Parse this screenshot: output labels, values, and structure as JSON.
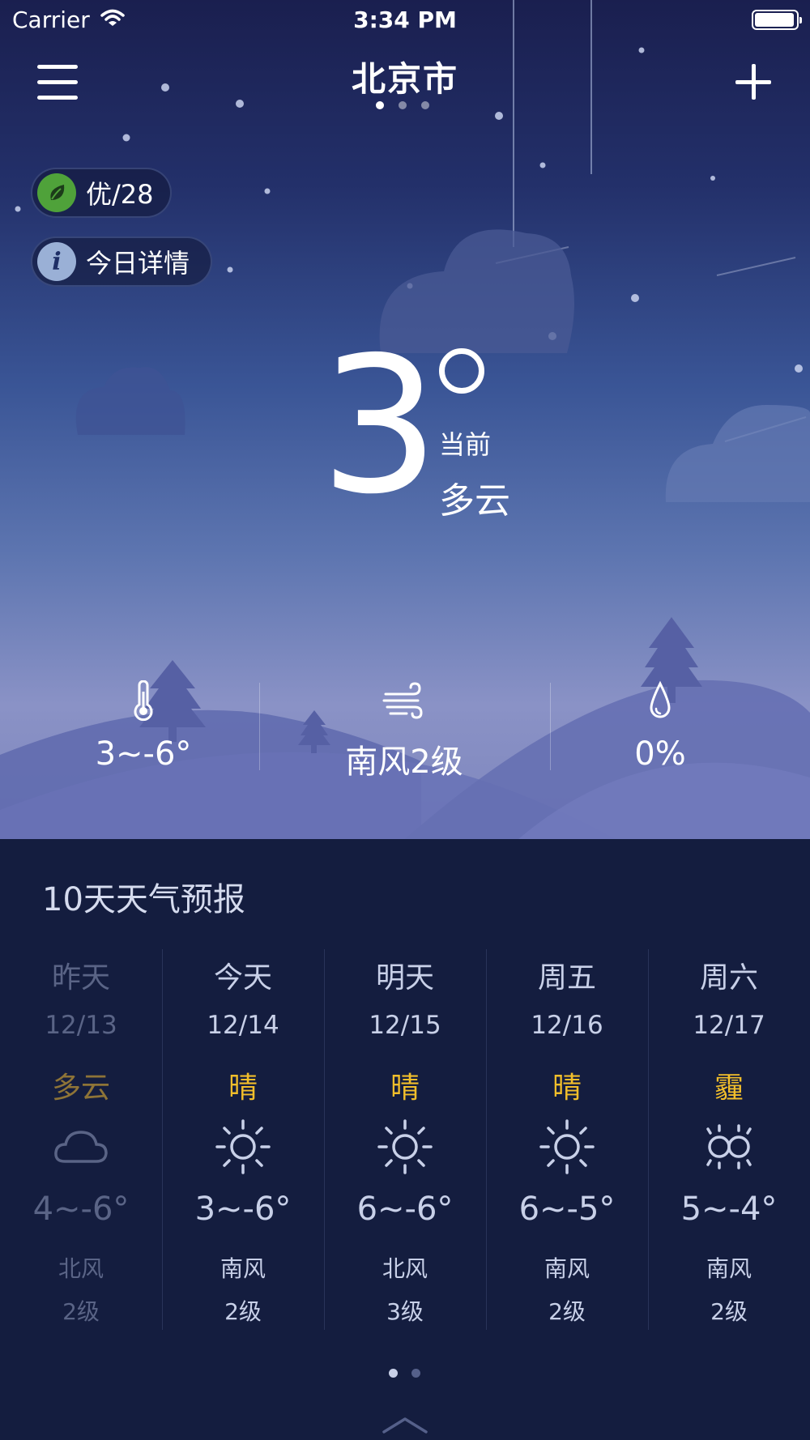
{
  "status_bar": {
    "carrier": "Carrier",
    "time": "3:34 PM"
  },
  "header": {
    "city": "北京市",
    "page_count": 3,
    "active_page": 0
  },
  "badges": {
    "aqi": "优/28",
    "detail": "今日详情"
  },
  "current": {
    "temp": "3",
    "label": "当前",
    "condition": "多云"
  },
  "stats": {
    "temp_range": "3~-6°",
    "wind": "南风2级",
    "humidity": "0%"
  },
  "forecast": {
    "title": "10天天气预报",
    "days": [
      {
        "name": "昨天",
        "date": "12/13",
        "condition": "多云",
        "icon": "cloud-icon",
        "temp": "4~-6°",
        "wind": "北风",
        "level": "2级",
        "past": true
      },
      {
        "name": "今天",
        "date": "12/14",
        "condition": "晴",
        "icon": "sun-icon",
        "temp": "3~-6°",
        "wind": "南风",
        "level": "2级",
        "past": false
      },
      {
        "name": "明天",
        "date": "12/15",
        "condition": "晴",
        "icon": "sun-icon",
        "temp": "6~-6°",
        "wind": "北风",
        "level": "3级",
        "past": false
      },
      {
        "name": "周五",
        "date": "12/16",
        "condition": "晴",
        "icon": "sun-icon",
        "temp": "6~-5°",
        "wind": "南风",
        "level": "2级",
        "past": false
      },
      {
        "name": "周六",
        "date": "12/17",
        "condition": "霾",
        "icon": "haze-icon",
        "temp": "5~-4°",
        "wind": "南风",
        "level": "2级",
        "past": false
      }
    ]
  },
  "pager": {
    "count": 2,
    "active": 0
  },
  "colors": {
    "condition_text": "#f1be2b",
    "panel_bg": "#141d3f",
    "aqi_green": "#4fa23a"
  }
}
